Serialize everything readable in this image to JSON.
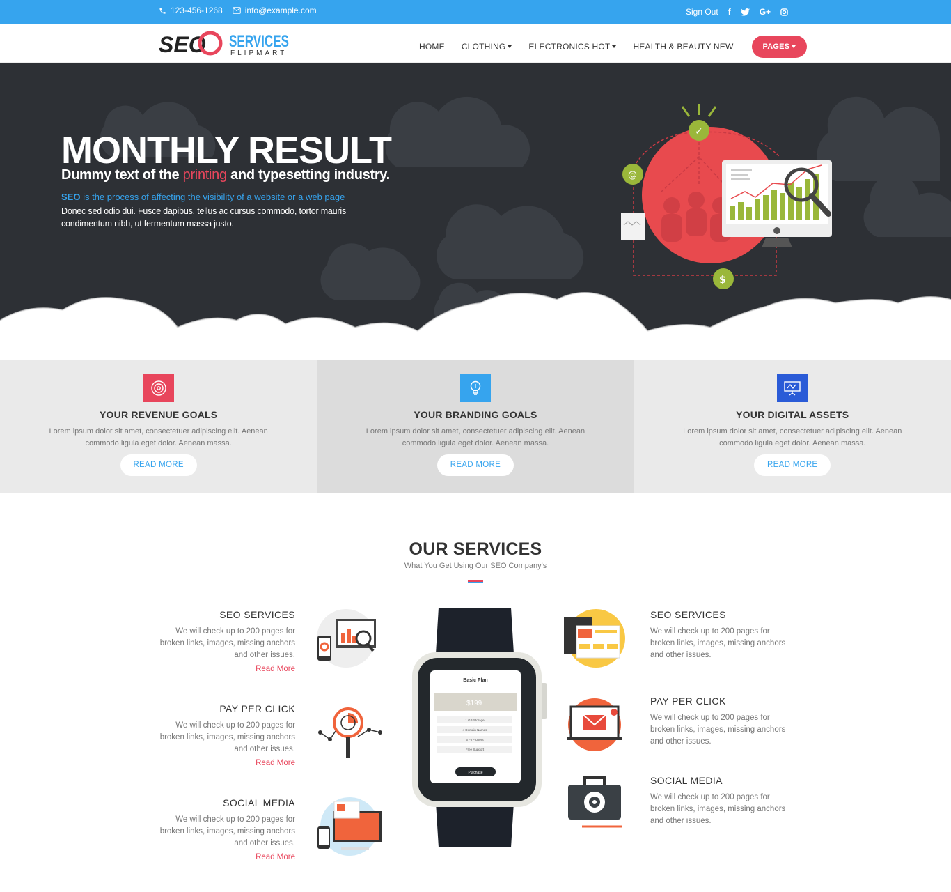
{
  "topbar": {
    "phone": "123-456-1268",
    "email": "info@example.com",
    "signout": "Sign Out",
    "social": [
      {
        "icon": "facebook-icon",
        "glyph": "f"
      },
      {
        "icon": "twitter-icon",
        "glyph": "t"
      },
      {
        "icon": "google-plus-icon",
        "glyph": "G+"
      },
      {
        "icon": "instagram-icon",
        "glyph": "◘"
      }
    ]
  },
  "logo": {
    "seo": "SEO",
    "services": "SERVICES",
    "flipmart": "FLIPMART"
  },
  "nav": {
    "home": "HOME",
    "clothing": "CLOTHING",
    "electronics": "ELECTRONICS HOT",
    "health": "HEALTH & BEAUTY NEW",
    "pages": "PAGES"
  },
  "hero": {
    "title": "MONTHLY RESULT",
    "sub_before": "Dummy text of the ",
    "sub_accent": "printing",
    "sub_after": " and typesetting industry.",
    "line1_bold": "SEO",
    "line1_rest": " is the process of affecting the visibility of a website or a web page",
    "line2": "Donec sed odio dui. Fusce dapibus, tellus ac cursus commodo, tortor mauris condimentum nibh, ut fermentum massa justo."
  },
  "goals": [
    {
      "title": "YOUR REVENUE GOALS",
      "text": "Lorem ipsum dolor sit amet, consectetuer adipiscing elit. Aenean commodo ligula eget dolor. Aenean massa.",
      "button": "READ MORE",
      "icon": "target-icon",
      "color": "#e8465c"
    },
    {
      "title": "YOUR BRANDING GOALS",
      "text": "Lorem ipsum dolor sit amet, consectetuer adipiscing elit. Aenean commodo ligula eget dolor. Aenean massa.",
      "button": "READ MORE",
      "icon": "lightbulb-icon",
      "color": "#36a4ee"
    },
    {
      "title": "YOUR DIGITAL ASSETS",
      "text": "Lorem ipsum dolor sit amet, consectetuer adipiscing elit. Aenean commodo ligula eget dolor. Aenean massa.",
      "button": "READ MORE",
      "icon": "presentation-icon",
      "color": "#2a5bd7"
    }
  ],
  "services": {
    "title": "OUR SERVICES",
    "subtitle": "What You Get Using Our SEO Company's",
    "left": [
      {
        "title": "SEO SERVICES",
        "text": "We will check up to 200 pages for broken links, images, missing anchors and other issues.",
        "link": "Read More"
      },
      {
        "title": "PAY PER CLICK",
        "text": "We will check up to 200 pages for broken links, images, missing anchors and other issues.",
        "link": "Read More"
      },
      {
        "title": "SOCIAL MEDIA",
        "text": "We will check up to 200 pages for broken links, images, missing anchors and other issues.",
        "link": "Read More"
      }
    ],
    "right": [
      {
        "title": "SEO SERVICES",
        "text": "We will check up to 200 pages for broken links, images, missing anchors and other issues."
      },
      {
        "title": "PAY PER CLICK",
        "text": "We will check up to 200 pages for broken links, images, missing anchors and other issues."
      },
      {
        "title": "SOCIAL MEDIA",
        "text": "We will check up to 200 pages for broken links, images, missing anchors and other issues."
      }
    ],
    "watch": {
      "plan": "Basic Plan",
      "price": "$199",
      "features": [
        "1 GB Storage",
        "4 Domain Names",
        "5 FTP Users",
        "Free Support"
      ],
      "button": "Purchase"
    }
  },
  "colors": {
    "topbar": "#36a4ee",
    "accent": "#e8465c",
    "hero_bg": "#2d3035"
  }
}
